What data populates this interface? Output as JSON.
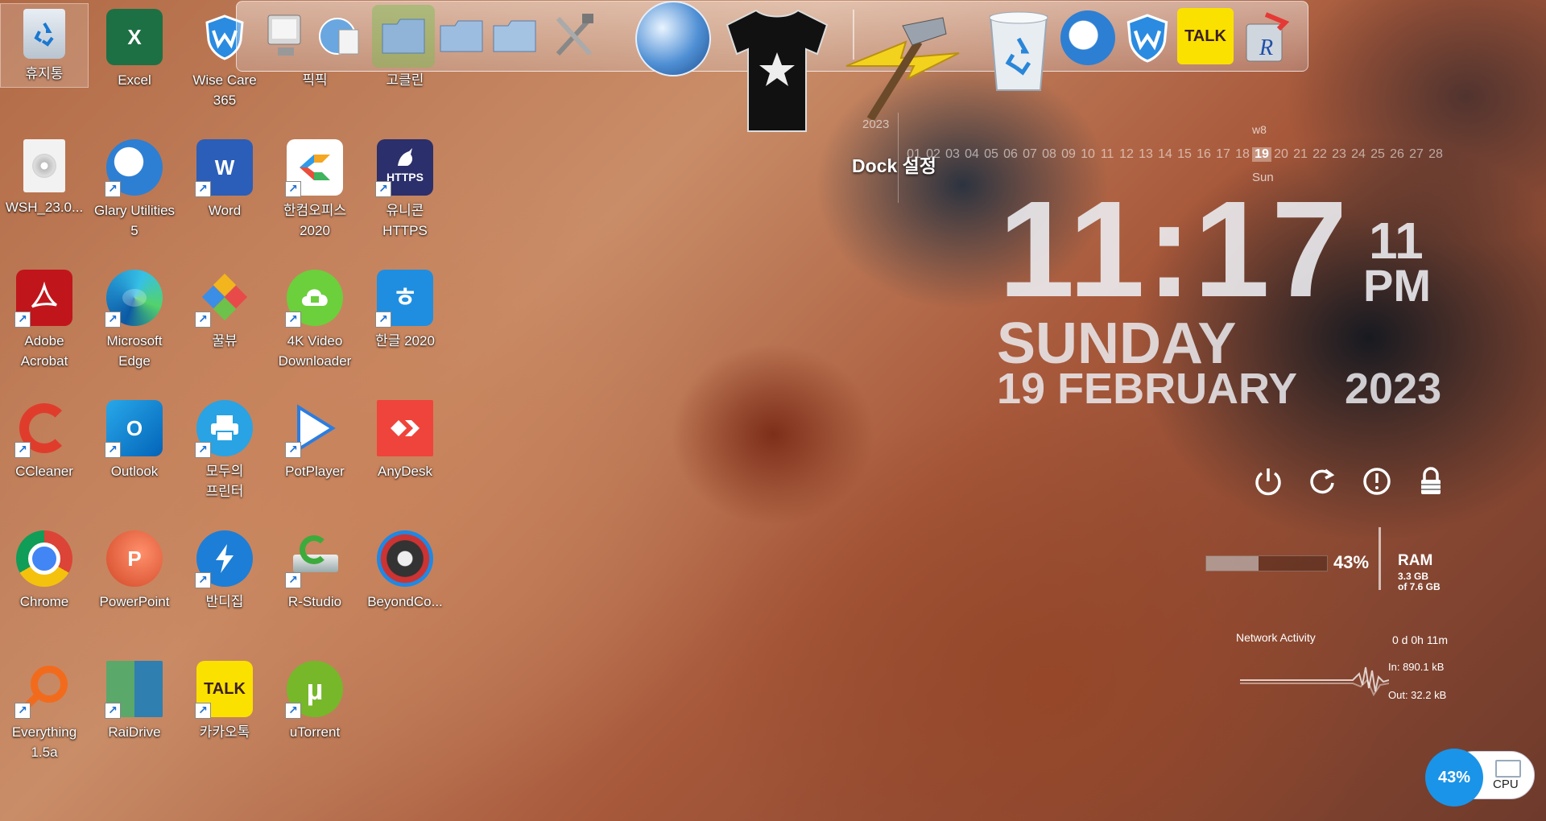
{
  "desktop": {
    "icons": [
      {
        "label": "휴지통"
      },
      {
        "label": "Excel"
      },
      {
        "label": "Wise Care\n365"
      },
      {
        "label": "픽픽"
      },
      {
        "label": "고클린"
      },
      {
        "label": "WSH_23.0..."
      },
      {
        "label": "Glary Utilities\n5"
      },
      {
        "label": "Word"
      },
      {
        "label": "한컴오피스\n2020"
      },
      {
        "label": "유니콘\nHTTPS"
      },
      {
        "label": "Adobe\nAcrobat"
      },
      {
        "label": "Microsoft\nEdge"
      },
      {
        "label": "꿀뷰"
      },
      {
        "label": "4K Video\nDownloader"
      },
      {
        "label": "한글 2020"
      },
      {
        "label": "CCleaner"
      },
      {
        "label": "Outlook"
      },
      {
        "label": "모두의\n프린터"
      },
      {
        "label": "PotPlayer"
      },
      {
        "label": "AnyDesk"
      },
      {
        "label": "Chrome"
      },
      {
        "label": "PowerPoint"
      },
      {
        "label": "반디집"
      },
      {
        "label": "R-Studio"
      },
      {
        "label": "BeyondCo..."
      },
      {
        "label": "Everything\n1.5a"
      },
      {
        "label": "RaiDrive"
      },
      {
        "label": "카카오톡"
      },
      {
        "label": "uTorrent"
      }
    ],
    "icon_glyphs": {
      "excel": "X",
      "word": "W",
      "outlook": "O",
      "powerpoint": "P",
      "https": "HTTPS",
      "hangul": "ㅎ",
      "kakao": "TALK",
      "utorrent": "µ"
    }
  },
  "dock": {
    "label": "Dock 설정",
    "kakao_text": "TALK",
    "items": [
      "monitor-icon",
      "globe-document-icon",
      "folder-icon",
      "folder-icon",
      "folder-icon",
      "tools-icon",
      "globe-icon",
      "tshirt-icon",
      "hammer-lightning-icon",
      "recycle-bin-icon",
      "glary-moon-icon",
      "wise-shield-icon",
      "kakaotalk-icon",
      "r-studio-icon"
    ]
  },
  "calendar": {
    "year": "2023",
    "week": "w8",
    "days": [
      "01",
      "02",
      "03",
      "04",
      "05",
      "06",
      "07",
      "08",
      "09",
      "10",
      "11",
      "12",
      "13",
      "14",
      "15",
      "16",
      "17",
      "18",
      "19",
      "20",
      "21",
      "22",
      "23",
      "24",
      "25",
      "26",
      "27",
      "28"
    ],
    "today": "19",
    "day_name": "Sun"
  },
  "clock": {
    "time": "11:17",
    "seconds": "11",
    "ampm": "PM",
    "weekday": "SUNDAY",
    "date": "19 FEBRUARY",
    "year": "2023"
  },
  "ram": {
    "percent": "43%",
    "percent_value": 43,
    "title": "RAM",
    "used": "3.3 GB",
    "total": "of 7.6 GB"
  },
  "network": {
    "title": "Network Activity",
    "uptime": "0 d 0h 11m",
    "in": "In: 890.1 kB",
    "out": "Out: 32.2 kB"
  },
  "cpu": {
    "percent": "43%",
    "label": "CPU"
  },
  "colors": {
    "excel": "#1d7044",
    "word": "#2b5eb8",
    "acrobat": "#c1151c",
    "edge": "#1e88c8",
    "chrome": "#dd4a3a",
    "powerpoint": "#d24726",
    "anydesk": "#ef443b",
    "kakao": "#fae100",
    "utorrent": "#76b82a",
    "cpu": "#1a94e8"
  }
}
